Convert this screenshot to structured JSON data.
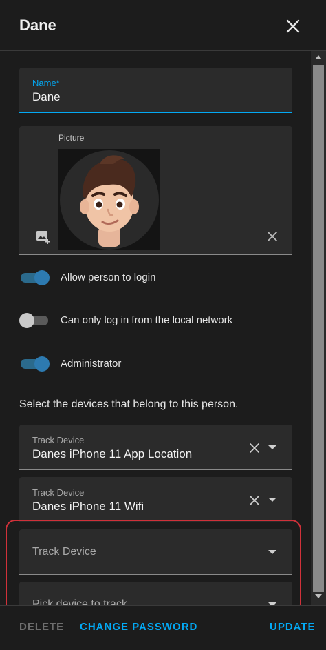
{
  "dialog": {
    "title": "Dane",
    "close_icon": "close-icon"
  },
  "name_field": {
    "label": "Name*",
    "value": "Dane"
  },
  "picture": {
    "label": "Picture",
    "image_alt": "memoji avatar",
    "upload_icon": "add-photo-icon",
    "clear_icon": "close-icon"
  },
  "toggles": [
    {
      "label": "Allow person to login",
      "on": true
    },
    {
      "label": "Can only log in from the local network",
      "on": false
    },
    {
      "label": "Administrator",
      "on": true
    }
  ],
  "devices_section": {
    "text": "Select the devices that belong to this person."
  },
  "device_fields": [
    {
      "label": "Track Device",
      "value": "Danes iPhone 11 App Location"
    },
    {
      "label": "Track Device",
      "value": "Danes iPhone 11 Wifi"
    },
    {
      "placeholder": "Track Device"
    },
    {
      "placeholder": "Pick device to track"
    }
  ],
  "footer": {
    "delete_label": "DELETE",
    "change_password_label": "CHANGE PASSWORD",
    "update_label": "UPDATE"
  },
  "colors": {
    "accent": "#03a9f4",
    "toggle_on": "#2d7ab0",
    "highlight": "#d0313a",
    "background": "#1c1c1c",
    "field": "#2b2b2b"
  }
}
